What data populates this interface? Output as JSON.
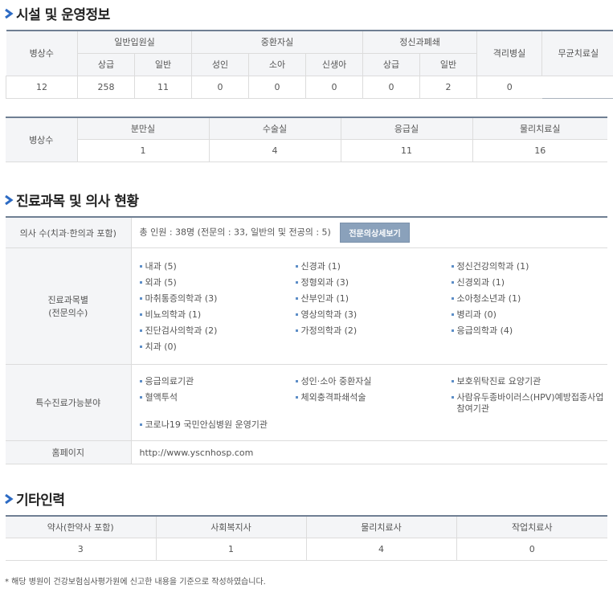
{
  "sections": {
    "facilities_title": "시설 및 운영정보",
    "doctors_title": "진료과목 및 의사 현황",
    "staff_title": "기타인력"
  },
  "beds": {
    "row_label": "병상수",
    "groups": [
      "일반입원실",
      "중환자실",
      "정신과폐쇄",
      "격리병실",
      "무균치료실"
    ],
    "sub_headers": [
      "상급",
      "일반",
      "성인",
      "소아",
      "신생아",
      "상급",
      "일반"
    ],
    "values": [
      "12",
      "258",
      "11",
      "0",
      "0",
      "0",
      "0",
      "2",
      "0"
    ]
  },
  "rooms": {
    "row_label": "병상수",
    "headers": [
      "분만실",
      "수술실",
      "응급실",
      "물리치료실"
    ],
    "values": [
      "1",
      "4",
      "11",
      "16"
    ]
  },
  "doctors": {
    "count_label": "의사 수(치과·한의과 포함)",
    "count_text": "총 인원 : 38명 (전문의 : 33, 일반의 및 전공의 : 5)",
    "detail_button": "전문의상세보기",
    "subjects_label_1": "진료과목별",
    "subjects_label_2": "(전문의수)",
    "subjects": [
      "내과 (5)",
      "신경과 (1)",
      "정신건강의학과 (1)",
      "외과 (5)",
      "정형외과 (3)",
      "신경외과 (1)",
      "마취통증의학과 (3)",
      "산부인과 (1)",
      "소아청소년과 (1)",
      "비뇨의학과 (1)",
      "영상의학과 (3)",
      "병리과 (0)",
      "진단검사의학과 (2)",
      "가정의학과 (2)",
      "응급의학과 (4)",
      "치과 (0)"
    ],
    "special_label": "특수진료가능분야",
    "special": [
      "응급의료기관",
      "성인·소아 중환자실",
      "보호위탁진료 요양기관",
      "혈액투석",
      "체외충격파쇄석술",
      "사람유두종바이러스(HPV)예방접종사업 참여기관",
      "코로나19 국민안심병원 운영기관"
    ],
    "homepage_label": "홈페이지",
    "homepage_url": "http://www.yscnhosp.com"
  },
  "staff": {
    "headers": [
      "약사(한약사 포함)",
      "사회복지사",
      "물리치료사",
      "작업치료사"
    ],
    "values": [
      "3",
      "1",
      "4",
      "0"
    ]
  },
  "footnote": "* 해당 병원이 건강보험심사평가원에 신고한 내용을 기준으로 작성하였습니다."
}
